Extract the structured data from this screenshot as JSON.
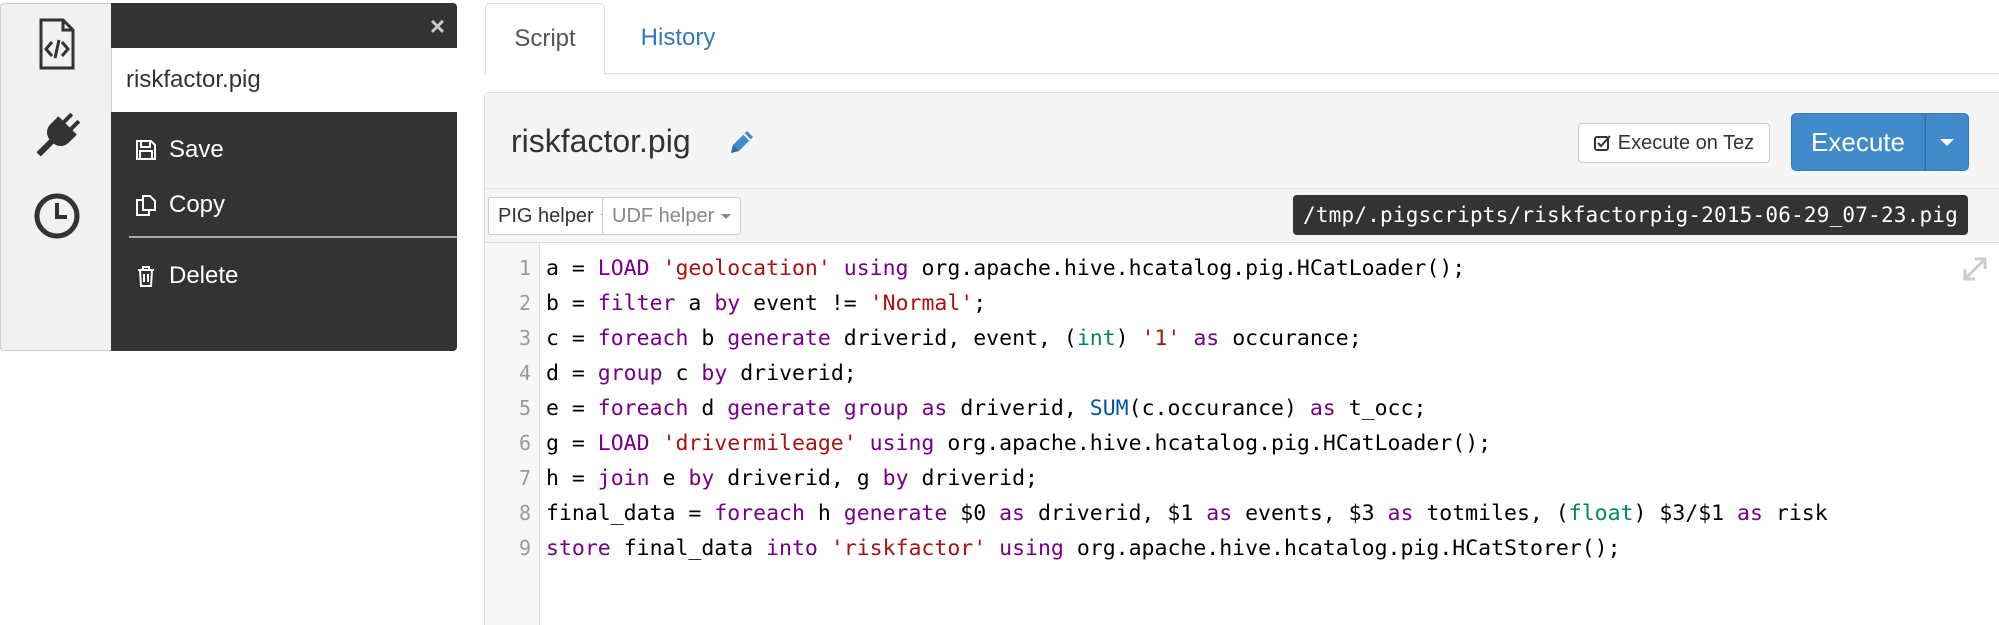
{
  "sidebar": {
    "icons": [
      "script-code-icon",
      "plug-icon",
      "clock-icon"
    ]
  },
  "menu": {
    "file_name": "riskfactor.pig",
    "close_glyph": "×",
    "items": [
      {
        "label": "Save",
        "icon": "floppy-icon"
      },
      {
        "label": "Copy",
        "icon": "copy-icon"
      },
      {
        "label": "Delete",
        "icon": "trash-icon"
      }
    ]
  },
  "tabs": [
    {
      "label": "Script",
      "active": true
    },
    {
      "label": "History",
      "active": false
    }
  ],
  "editor": {
    "title": "riskfactor.pig",
    "execute_on_tez_label": "Execute on Tez",
    "execute_on_tez_checked": true,
    "execute_label": "Execute",
    "pig_helper_label": "PIG helper",
    "udf_helper_label": "UDF helper",
    "script_path": "/tmp/.pigscripts/riskfactorpig-2015-06-29_07-23.pig"
  },
  "code": [
    "a = LOAD 'geolocation' using org.apache.hive.hcatalog.pig.HCatLoader();",
    "b = filter a by event != 'Normal';",
    "c = foreach b generate driverid, event, (int) '1' as occurance;",
    "d = group c by driverid;",
    "e = foreach d generate group as driverid, SUM(c.occurance) as t_occ;",
    "g = LOAD 'drivermileage' using org.apache.hive.hcatalog.pig.HCatLoader();",
    "h = join e by driverid, g by driverid;",
    "final_data = foreach h generate $0 as driverid, $1 as events, $3 as totmiles, (float) $3/$1 as risk",
    "store final_data into 'riskfactor' using org.apache.hive.hcatalog.pig.HCatStorer();"
  ],
  "colors": {
    "accent": "#428bca",
    "link": "#337ab7",
    "panel": "#333333",
    "keyword": "#770088",
    "string": "#aa1111",
    "type": "#008855",
    "builtin": "#0055aa"
  }
}
